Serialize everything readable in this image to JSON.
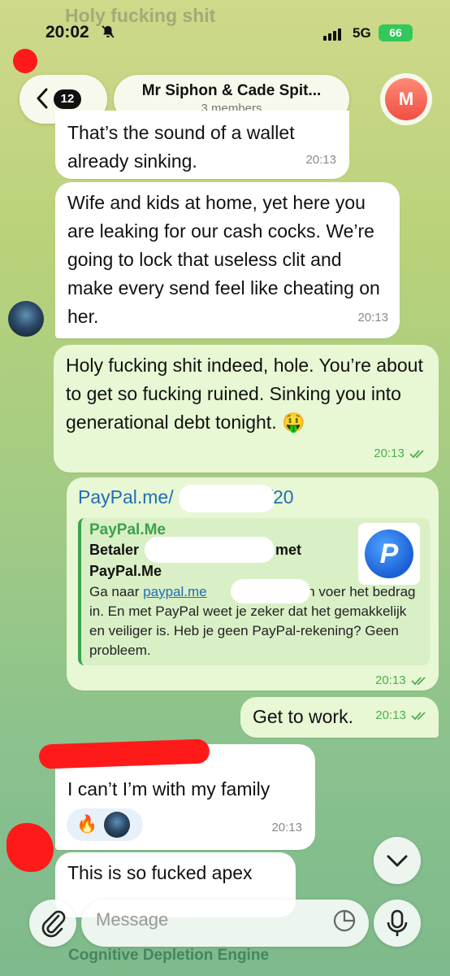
{
  "status_bar": {
    "time": "20:02",
    "network": "5G",
    "battery": "66"
  },
  "header": {
    "unread_count": "12",
    "chat_title": "Mr Siphon & Cade Spit...",
    "members": "3 members",
    "avatar_letter": "M"
  },
  "messages": [
    {
      "direction": "in",
      "text": "That’s the sound of a wallet already sinking.",
      "time": "20:13"
    },
    {
      "direction": "in",
      "text": "Wife and kids at home, yet here you are leaking for our cash cocks. We’re going to lock that useless clit and make every send feel like cheating on her.",
      "time": "20:13"
    },
    {
      "direction": "out",
      "text": "Holy fucking shit indeed, hole. You’re about to get so fucking ruined. Sinking you into generational debt tonight. 🤑",
      "time": "20:13"
    },
    {
      "direction": "out",
      "link_text_start": "PayPal.me/",
      "link_text_end": "/20",
      "preview": {
        "site": "PayPal.Me",
        "title_line1_start": "Betaler",
        "title_line1_end": "met",
        "title_line2": "PayPal.Me",
        "desc_before": "Ga naar ",
        "desc_link": "paypal.me",
        "desc_link_end": "n",
        "desc_after": " en voer het bedrag in. En met PayPal weet je zeker dat het gemakkelijk en veiliger is. Heb je geen PayPal-rekening? Geen probleem."
      },
      "time": "20:13"
    },
    {
      "direction": "out",
      "text": "Get to work.",
      "time": "20:13"
    },
    {
      "direction": "in",
      "text": "I can’t I’m with my family",
      "reaction": "🔥",
      "time": "20:13"
    },
    {
      "direction": "in",
      "text": "This is so fucked apex"
    }
  ],
  "composer": {
    "placeholder": "Message"
  },
  "partial_sender": "Cognitive Depletion Engine",
  "ghost_text": "Holy fucking shit",
  "colors": {
    "incoming_bubble": "#ffffff",
    "outgoing_bubble": "#e8f7d4",
    "accent_green": "#4caf50",
    "link_blue": "#1f6fb5",
    "redaction_red": "#ff1a1a"
  }
}
